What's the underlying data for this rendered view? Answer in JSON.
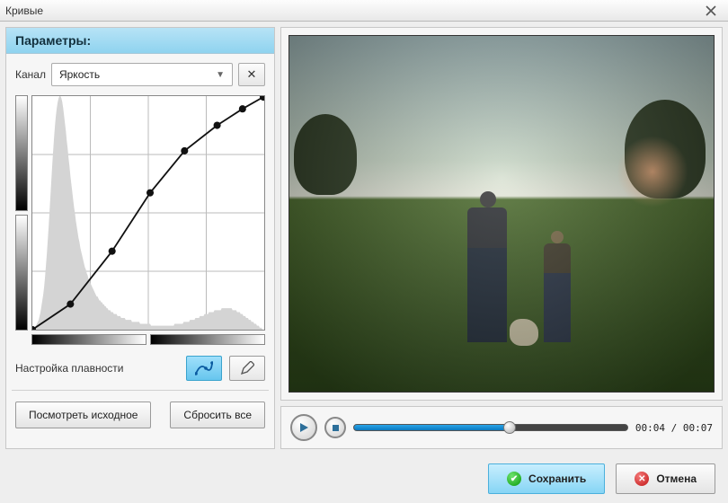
{
  "window": {
    "title": "Кривые"
  },
  "params": {
    "heading": "Параметры:",
    "channel_label": "Канал",
    "channel_value": "Яркость",
    "smooth_label": "Настройка плавности",
    "view_original": "Посмотреть исходное",
    "reset_all": "Сбросить все"
  },
  "player": {
    "current": "00:04",
    "duration": "00:07",
    "progress_pct": 57
  },
  "footer": {
    "save": "Сохранить",
    "cancel": "Отмена"
  },
  "chart_data": {
    "type": "line",
    "title": "",
    "xlabel": "",
    "ylabel": "",
    "xlim": [
      0,
      255
    ],
    "ylim": [
      0,
      255
    ],
    "grid": true,
    "curve_points": [
      {
        "x": 0,
        "y": 0
      },
      {
        "x": 42,
        "y": 28
      },
      {
        "x": 88,
        "y": 86
      },
      {
        "x": 130,
        "y": 150
      },
      {
        "x": 168,
        "y": 196
      },
      {
        "x": 204,
        "y": 224
      },
      {
        "x": 232,
        "y": 242
      },
      {
        "x": 255,
        "y": 255
      }
    ],
    "histogram": [
      0,
      0,
      0,
      1,
      2,
      3,
      4,
      5,
      7,
      9,
      12,
      15,
      18,
      22,
      27,
      33,
      39,
      46,
      53,
      61,
      69,
      77,
      85,
      92,
      99,
      105,
      110,
      114,
      117,
      119,
      120,
      120,
      119,
      117,
      114,
      110,
      106,
      102,
      97,
      93,
      88,
      84,
      79,
      75,
      71,
      67,
      63,
      60,
      56,
      53,
      50,
      47,
      45,
      42,
      40,
      38,
      36,
      34,
      32,
      31,
      29,
      28,
      26,
      25,
      24,
      23,
      22,
      21,
      20,
      19,
      18,
      17,
      17,
      16,
      15,
      15,
      14,
      14,
      13,
      13,
      12,
      12,
      11,
      11,
      10,
      10,
      10,
      9,
      9,
      9,
      8,
      8,
      8,
      8,
      7,
      7,
      7,
      7,
      6,
      6,
      6,
      6,
      6,
      5,
      5,
      5,
      5,
      5,
      5,
      5,
      4,
      4,
      4,
      4,
      4,
      4,
      4,
      4,
      4,
      3,
      3,
      3,
      3,
      3,
      3,
      3,
      3,
      3,
      3,
      3,
      3,
      2,
      2,
      2,
      2,
      2,
      2,
      2,
      2,
      2,
      2,
      2,
      2,
      2,
      2,
      2,
      2,
      2,
      2,
      2,
      2,
      2,
      2,
      2,
      2,
      2,
      2,
      3,
      3,
      3,
      3,
      3,
      3,
      3,
      3,
      3,
      3,
      4,
      4,
      4,
      4,
      4,
      4,
      4,
      5,
      5,
      5,
      5,
      5,
      5,
      6,
      6,
      6,
      6,
      6,
      7,
      7,
      7,
      7,
      7,
      8,
      8,
      8,
      8,
      8,
      9,
      9,
      9,
      9,
      9,
      9,
      10,
      10,
      10,
      10,
      10,
      10,
      10,
      10,
      11,
      11,
      11,
      11,
      11,
      11,
      11,
      11,
      11,
      11,
      11,
      11,
      10,
      10,
      10,
      10,
      10,
      9,
      9,
      9,
      9,
      8,
      8,
      8,
      7,
      7,
      7,
      6,
      6,
      6,
      5,
      5,
      5,
      4,
      4,
      4,
      3,
      3,
      3,
      2,
      2,
      2,
      1,
      1,
      1,
      0,
      0
    ]
  }
}
